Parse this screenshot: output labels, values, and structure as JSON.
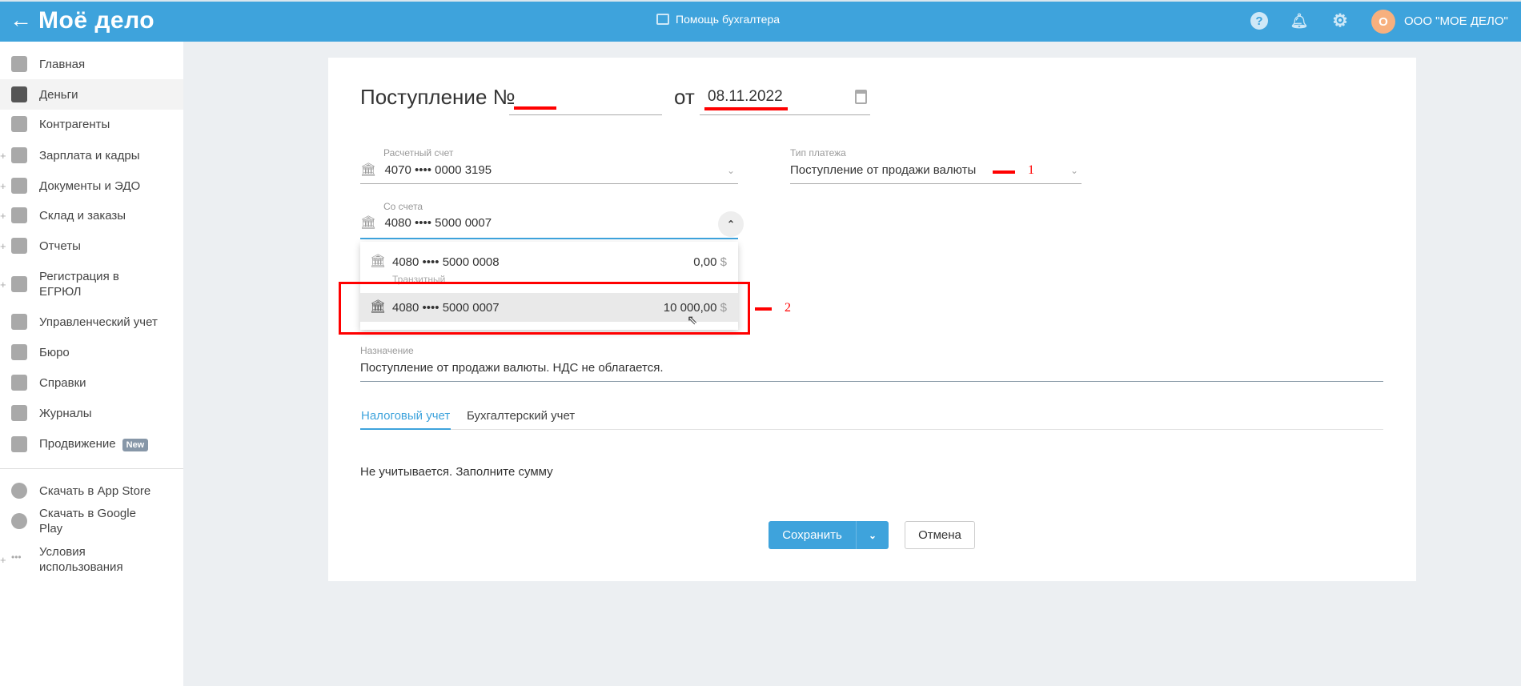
{
  "header": {
    "back_icon": "arrow-left-icon",
    "logo": "Моё дело",
    "center_title": "Помощь бухгалтера",
    "org_initial": "О",
    "org_name": "ООО \"МОЕ ДЕЛО\""
  },
  "sidebar": {
    "items": [
      {
        "label": "Главная",
        "icon": "home-icon"
      },
      {
        "label": "Деньги",
        "icon": "money-icon",
        "active": true
      },
      {
        "label": "Контрагенты",
        "icon": "contractor-icon"
      },
      {
        "label": "Зарплата и кадры",
        "icon": "wallet-icon",
        "plus": true
      },
      {
        "label": "Документы и ЭДО",
        "icon": "folder-icon",
        "plus": true
      },
      {
        "label": "Склад и заказы",
        "icon": "warehouse-icon",
        "plus": true
      },
      {
        "label": "Отчеты",
        "icon": "report-icon",
        "plus": true
      },
      {
        "label": "Регистрация в ЕГРЮЛ",
        "icon": "registration-icon",
        "plus": true
      },
      {
        "label": "Управленческий учет",
        "icon": "management-icon"
      },
      {
        "label": "Бюро",
        "icon": "briefcase-icon"
      },
      {
        "label": "Справки",
        "icon": "reference-icon"
      },
      {
        "label": "Журналы",
        "icon": "journal-icon"
      },
      {
        "label": "Продвижение",
        "icon": "chart-icon",
        "badge": "New"
      }
    ],
    "bottom_items": [
      {
        "label": "Скачать в App Store",
        "icon": "apple-icon"
      },
      {
        "label": "Скачать в Google Play",
        "icon": "google-play-icon"
      },
      {
        "label": "Условия использования",
        "icon": "more-icon"
      }
    ]
  },
  "form": {
    "title": "Поступление №",
    "date_prefix": "от",
    "date": "08.11.2022",
    "account_label": "Расчетный счет",
    "account_value": "4070 •••• 0000 3195",
    "type_label": "Тип платежа",
    "type_value": "Поступление от продажи валюты",
    "from_label": "Со счета",
    "from_value": "4080 •••• 5000 0007",
    "dropdown": [
      {
        "account": "4080 •••• 5000 0008",
        "amount": "0,00",
        "currency": "$",
        "note": "Транзитный"
      },
      {
        "account": "4080 •••• 5000 0007",
        "amount": "10 000,00",
        "currency": "$"
      }
    ],
    "purpose_label": "Назначение",
    "purpose_value": "Поступление от продажи валюты. НДС не облагается.",
    "tabs": [
      "Налоговый учет",
      "Бухгалтерский учет"
    ],
    "tab_content": "Не учитывается. Заполните сумму",
    "save": "Сохранить",
    "cancel": "Отмена"
  },
  "annotations": {
    "mark1": "1",
    "mark2": "2"
  },
  "colors": {
    "accent": "#3ea3dc",
    "annotation": "#ff0000"
  }
}
